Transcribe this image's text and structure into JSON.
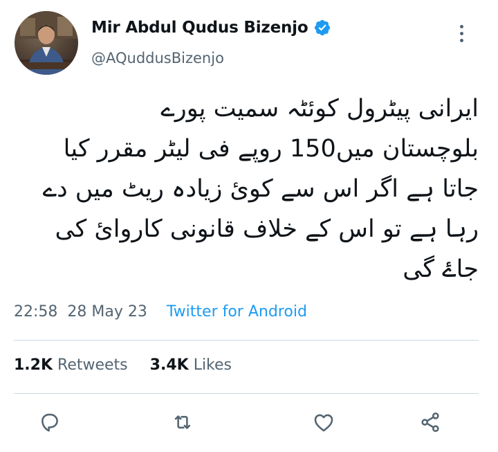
{
  "author": {
    "display_name": "Mir Abdul Qudus Bizenjo",
    "handle": "@AQuddusBizenjo"
  },
  "tweet": {
    "text_lines": [
      "ایرانی پیٹرول کوئٹہ سمیت پورے",
      "بلوچستان میں150 روپے فی لیٹر مقرر کیا",
      "جاتا ہے اگر اس سے کوئ زیادہ ریٹ میں دے",
      "رہا ہے تو اس کے خلاف قانونی کاروائ کی",
      "جاۓ گی"
    ],
    "time": "22:58",
    "date": "28 May 23",
    "source": "Twitter for Android"
  },
  "stats": {
    "retweets_count": "1.2K",
    "retweets_label": "Retweets",
    "likes_count": "3.4K",
    "likes_label": "Likes"
  },
  "actions": {
    "reply_icon": "reply-icon",
    "retweet_icon": "retweet-icon",
    "like_icon": "like-icon",
    "share_icon": "share-icon"
  },
  "colors": {
    "accent": "#1d9bf0",
    "secondary_text": "#536471",
    "primary_text": "#0f1419",
    "divider": "#cfd9de"
  }
}
